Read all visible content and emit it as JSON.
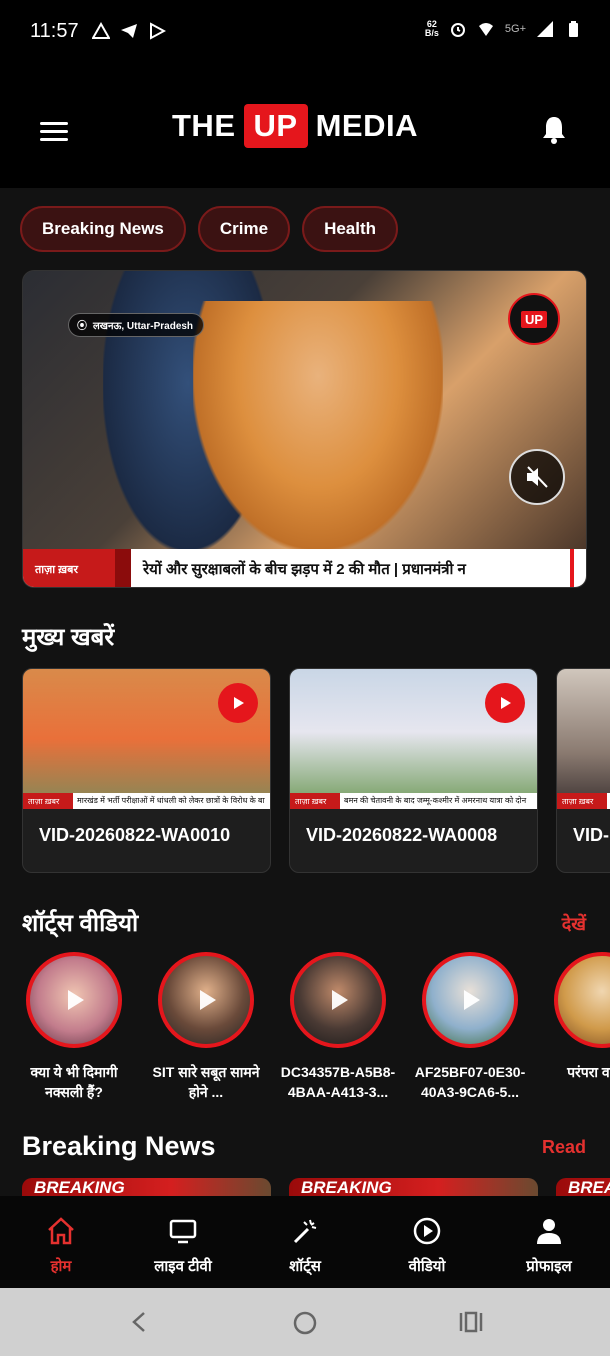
{
  "status_bar": {
    "time": "11:57",
    "speed_value": "62",
    "speed_unit": "B/s",
    "network": "5G+"
  },
  "header": {
    "logo_the": "THE",
    "logo_up": "UP",
    "logo_media": "MEDIA"
  },
  "categories": [
    "Breaking News",
    "Crime",
    "Health"
  ],
  "hero": {
    "location": "लखनऊ, Uttar-Pradesh",
    "badge": "UP",
    "ticker_label": "ताज़ा ख़बर",
    "ticker_text": "रेयों और सुरक्षाबलों के बीच झड़प में 2 की मौत   |   प्रधानमंत्री न"
  },
  "main_news": {
    "title": "मुख्य खबरें",
    "videos": [
      {
        "title": "VID-20260822-WA0010",
        "strip_label": "ताज़ा ख़बर",
        "strip_text": "मारखंड में भर्ती परीक्षाओं में धांधली को लेकर छात्रों के विरोध के बा"
      },
      {
        "title": "VID-20260822-WA0008",
        "strip_label": "ताज़ा ख़बर",
        "strip_text": "बमन की चेतावनी के बाद जम्मू-कश्मीर में अमरनाथ यात्रा को दोन"
      },
      {
        "title": "VID-",
        "strip_label": "ताज़ा ख़बर",
        "strip_text": ""
      }
    ]
  },
  "shorts": {
    "title": "शॉर्ट्स वीडियो",
    "view_all": "देखें",
    "items": [
      {
        "label": "क्या ये भी दिमागी नक्सली हैं?"
      },
      {
        "label": "SIT सारे सबूत सामने होने ..."
      },
      {
        "label": "DC34357B-A5B8-4BAA-A413-3..."
      },
      {
        "label": "AF25BF07-0E30-40A3-9CA6-5..."
      },
      {
        "label": "परंपरा वह नय"
      }
    ]
  },
  "breaking": {
    "title": "Breaking News",
    "view_all": "Read",
    "card_label": "BREAKING"
  },
  "bottom_nav": [
    {
      "label": "होम",
      "icon": "home-icon",
      "active": true
    },
    {
      "label": "लाइव टीवी",
      "icon": "tv-icon",
      "active": false
    },
    {
      "label": "शॉर्ट्स",
      "icon": "magic-wand-icon",
      "active": false
    },
    {
      "label": "वीडियो",
      "icon": "play-circle-icon",
      "active": false
    },
    {
      "label": "प्रोफाइल",
      "icon": "person-icon",
      "active": false
    }
  ],
  "colors": {
    "accent": "#e5161c",
    "background": "#121212",
    "header": "#000000"
  }
}
